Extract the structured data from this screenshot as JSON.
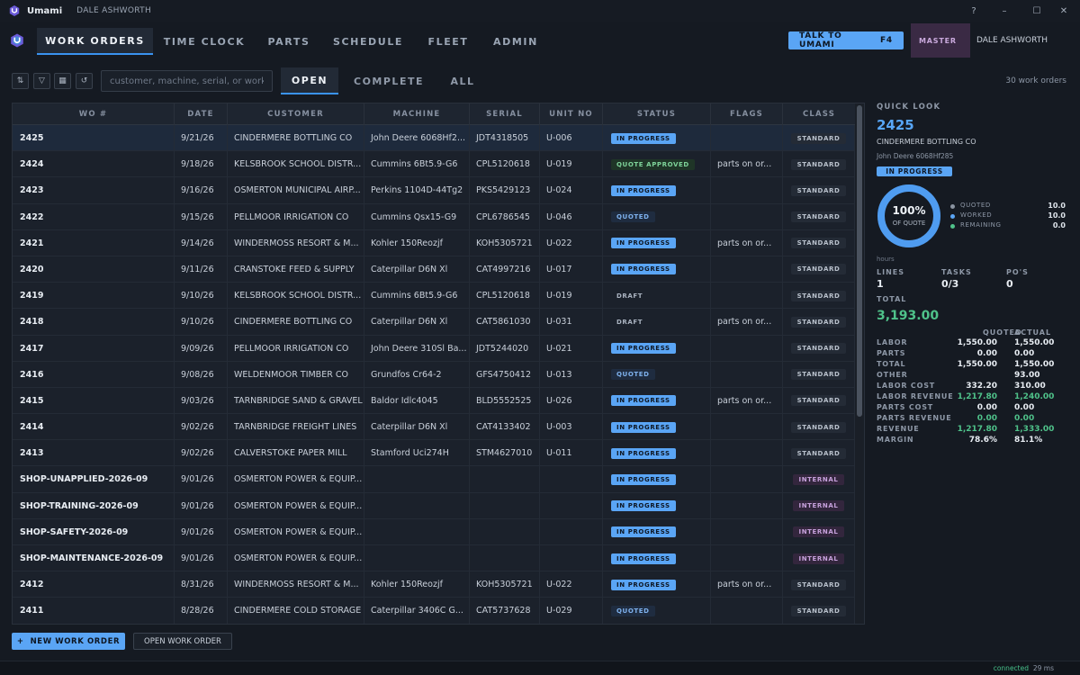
{
  "app": {
    "name": "Umami",
    "user": "DALE ASHWORTH"
  },
  "window_controls": {
    "help": "?",
    "minimize": "–",
    "maximize": "☐",
    "close": "✕"
  },
  "nav": {
    "tabs": [
      {
        "label": "WORK ORDERS",
        "active": true
      },
      {
        "label": "TIME CLOCK"
      },
      {
        "label": "PARTS"
      },
      {
        "label": "SCHEDULE"
      },
      {
        "label": "FLEET"
      },
      {
        "label": "ADMIN"
      }
    ],
    "talk_label": "TALK TO UMAMI",
    "talk_key": "F4",
    "role": "MASTER",
    "user": "DALE ASHWORTH"
  },
  "toolbar": {
    "icons": [
      "sort-icon",
      "filter-icon",
      "columns-icon",
      "refresh-icon"
    ],
    "search_placeholder": "customer, machine, serial, or work ...",
    "filters": [
      {
        "label": "OPEN",
        "active": true
      },
      {
        "label": "COMPLETE"
      },
      {
        "label": "ALL"
      }
    ],
    "count_text": "30 work orders"
  },
  "table": {
    "columns": [
      "WO #",
      "DATE",
      "CUSTOMER",
      "MACHINE",
      "SERIAL",
      "UNIT NO",
      "STATUS",
      "FLAGS",
      "CLASS"
    ],
    "rows": [
      {
        "wo": "2425",
        "date": "9/21/26",
        "customer": "CINDERMERE BOTTLING CO",
        "machine": "John Deere 6068Hf2...",
        "serial": "JDT4318505",
        "unit": "U-006",
        "status": "IN PROGRESS",
        "status_kind": "inprog",
        "flags": "",
        "cls": "STANDARD",
        "cls_kind": "standard",
        "selected": true
      },
      {
        "wo": "2424",
        "date": "9/18/26",
        "customer": "KELSBROOK SCHOOL DISTR...",
        "machine": "Cummins 6Bt5.9-G6",
        "serial": "CPL5120618",
        "unit": "U-019",
        "status": "QUOTE APPROVED",
        "status_kind": "approved",
        "flags": "parts on or...",
        "cls": "STANDARD",
        "cls_kind": "standard"
      },
      {
        "wo": "2423",
        "date": "9/16/26",
        "customer": "OSMERTON MUNICIPAL AIRP...",
        "machine": "Perkins 1104D-44Tg2",
        "serial": "PKS5429123",
        "unit": "U-024",
        "status": "IN PROGRESS",
        "status_kind": "inprog",
        "flags": "",
        "cls": "STANDARD",
        "cls_kind": "standard"
      },
      {
        "wo": "2422",
        "date": "9/15/26",
        "customer": "PELLMOOR IRRIGATION CO",
        "machine": "Cummins Qsx15-G9",
        "serial": "CPL6786545",
        "unit": "U-046",
        "status": "QUOTED",
        "status_kind": "quoted",
        "flags": "",
        "cls": "STANDARD",
        "cls_kind": "standard"
      },
      {
        "wo": "2421",
        "date": "9/14/26",
        "customer": "WINDERMOSS RESORT & M...",
        "machine": "Kohler 150Reozjf",
        "serial": "KOH5305721",
        "unit": "U-022",
        "status": "IN PROGRESS",
        "status_kind": "inprog",
        "flags": "parts on or...",
        "cls": "STANDARD",
        "cls_kind": "standard"
      },
      {
        "wo": "2420",
        "date": "9/11/26",
        "customer": "CRANSTOKE FEED & SUPPLY",
        "machine": "Caterpillar D6N Xl",
        "serial": "CAT4997216",
        "unit": "U-017",
        "status": "IN PROGRESS",
        "status_kind": "inprog",
        "flags": "",
        "cls": "STANDARD",
        "cls_kind": "standard"
      },
      {
        "wo": "2419",
        "date": "9/10/26",
        "customer": "KELSBROOK SCHOOL DISTR...",
        "machine": "Cummins 6Bt5.9-G6",
        "serial": "CPL5120618",
        "unit": "U-019",
        "status": "DRAFT",
        "status_kind": "draft",
        "flags": "",
        "cls": "STANDARD",
        "cls_kind": "standard"
      },
      {
        "wo": "2418",
        "date": "9/10/26",
        "customer": "CINDERMERE BOTTLING CO",
        "machine": "Caterpillar D6N Xl",
        "serial": "CAT5861030",
        "unit": "U-031",
        "status": "DRAFT",
        "status_kind": "draft",
        "flags": "parts on or...",
        "cls": "STANDARD",
        "cls_kind": "standard"
      },
      {
        "wo": "2417",
        "date": "9/09/26",
        "customer": "PELLMOOR IRRIGATION CO",
        "machine": "John Deere 310Sl Ba...",
        "serial": "JDT5244020",
        "unit": "U-021",
        "status": "IN PROGRESS",
        "status_kind": "inprog",
        "flags": "",
        "cls": "STANDARD",
        "cls_kind": "standard"
      },
      {
        "wo": "2416",
        "date": "9/08/26",
        "customer": "WELDENMOOR TIMBER CO",
        "machine": "Grundfos Cr64-2",
        "serial": "GFS4750412",
        "unit": "U-013",
        "status": "QUOTED",
        "status_kind": "quoted",
        "flags": "",
        "cls": "STANDARD",
        "cls_kind": "standard"
      },
      {
        "wo": "2415",
        "date": "9/03/26",
        "customer": "TARNBRIDGE SAND & GRAVEL",
        "machine": "Baldor Idlc4045",
        "serial": "BLD5552525",
        "unit": "U-026",
        "status": "IN PROGRESS",
        "status_kind": "inprog",
        "flags": "parts on or...",
        "cls": "STANDARD",
        "cls_kind": "standard"
      },
      {
        "wo": "2414",
        "date": "9/02/26",
        "customer": "TARNBRIDGE FREIGHT LINES",
        "machine": "Caterpillar D6N Xl",
        "serial": "CAT4133402",
        "unit": "U-003",
        "status": "IN PROGRESS",
        "status_kind": "inprog",
        "flags": "",
        "cls": "STANDARD",
        "cls_kind": "standard"
      },
      {
        "wo": "2413",
        "date": "9/02/26",
        "customer": "CALVERSTOKE PAPER MILL",
        "machine": "Stamford Uci274H",
        "serial": "STM4627010",
        "unit": "U-011",
        "status": "IN PROGRESS",
        "status_kind": "inprog",
        "flags": "",
        "cls": "STANDARD",
        "cls_kind": "standard"
      },
      {
        "wo": "SHOP-UNAPPLIED-2026-09",
        "date": "9/01/26",
        "customer": "OSMERTON POWER & EQUIP...",
        "machine": "",
        "serial": "",
        "unit": "",
        "status": "IN PROGRESS",
        "status_kind": "inprog",
        "flags": "",
        "cls": "INTERNAL",
        "cls_kind": "internal"
      },
      {
        "wo": "SHOP-TRAINING-2026-09",
        "date": "9/01/26",
        "customer": "OSMERTON POWER & EQUIP...",
        "machine": "",
        "serial": "",
        "unit": "",
        "status": "IN PROGRESS",
        "status_kind": "inprog",
        "flags": "",
        "cls": "INTERNAL",
        "cls_kind": "internal"
      },
      {
        "wo": "SHOP-SAFETY-2026-09",
        "date": "9/01/26",
        "customer": "OSMERTON POWER & EQUIP...",
        "machine": "",
        "serial": "",
        "unit": "",
        "status": "IN PROGRESS",
        "status_kind": "inprog",
        "flags": "",
        "cls": "INTERNAL",
        "cls_kind": "internal"
      },
      {
        "wo": "SHOP-MAINTENANCE-2026-09",
        "date": "9/01/26",
        "customer": "OSMERTON POWER & EQUIP...",
        "machine": "",
        "serial": "",
        "unit": "",
        "status": "IN PROGRESS",
        "status_kind": "inprog",
        "flags": "",
        "cls": "INTERNAL",
        "cls_kind": "internal"
      },
      {
        "wo": "2412",
        "date": "8/31/26",
        "customer": "WINDERMOSS RESORT & M...",
        "machine": "Kohler 150Reozjf",
        "serial": "KOH5305721",
        "unit": "U-022",
        "status": "IN PROGRESS",
        "status_kind": "inprog",
        "flags": "parts on or...",
        "cls": "STANDARD",
        "cls_kind": "standard"
      },
      {
        "wo": "2411",
        "date": "8/28/26",
        "customer": "CINDERMERE COLD STORAGE",
        "machine": "Caterpillar 3406C G...",
        "serial": "CAT5737628",
        "unit": "U-029",
        "status": "QUOTED",
        "status_kind": "quoted",
        "flags": "",
        "cls": "STANDARD",
        "cls_kind": "standard"
      }
    ]
  },
  "actions": {
    "new_wo": "NEW WORK ORDER",
    "new_wo_icon": "+",
    "open_wo": "OPEN WORK ORDER"
  },
  "status_bar": {
    "connection": "connected",
    "separator": "·",
    "latency": "29 ms"
  },
  "quick_look": {
    "title": "QUICK LOOK",
    "wo": "2425",
    "customer": "CINDERMERE BOTTLING CO",
    "machine": "John Deere 6068Hf285",
    "status": "IN PROGRESS",
    "pct": "100%",
    "pct_label": "OF QUOTE",
    "pct_value": 1.0,
    "legend": [
      {
        "name": "QUOTED",
        "value": "10.0",
        "color": "#8a93a0"
      },
      {
        "name": "WORKED",
        "value": "10.0",
        "color": "#5aa5f5"
      },
      {
        "name": "REMAINING",
        "value": "0.0",
        "color": "#4fc28a"
      }
    ],
    "hours_label": "hours",
    "kpis": [
      {
        "label": "LINES",
        "value": "1"
      },
      {
        "label": "TASKS",
        "value": "0/3"
      },
      {
        "label": "PO'S",
        "value": "0"
      }
    ],
    "total_label": "TOTAL",
    "total_value": "3,193.00",
    "fin_headers": {
      "quoted": "QUOTED",
      "actual": "ACTUAL"
    },
    "financials": [
      {
        "label": "LABOR",
        "quoted": "1,550.00",
        "actual": "1,550.00"
      },
      {
        "label": "PARTS",
        "quoted": "0.00",
        "actual": "0.00"
      },
      {
        "label": "TOTAL",
        "quoted": "1,550.00",
        "actual": "1,550.00"
      },
      {
        "label": "OTHER",
        "quoted": "",
        "actual": "93.00"
      },
      {
        "label": "LABOR COST",
        "quoted": "332.20",
        "actual": "310.00"
      },
      {
        "label": "LABOR REVENUE",
        "quoted": "1,217.80",
        "actual": "1,240.00",
        "green": true
      },
      {
        "label": "PARTS COST",
        "quoted": "0.00",
        "actual": "0.00"
      },
      {
        "label": "PARTS REVENUE",
        "quoted": "0.00",
        "actual": "0.00",
        "green": true
      },
      {
        "label": "REVENUE",
        "quoted": "1,217.80",
        "actual": "1,333.00",
        "green": true
      },
      {
        "label": "MARGIN",
        "quoted": "78.6%",
        "actual": "81.1%"
      }
    ]
  },
  "colors": {
    "accent": "#5aa5f5",
    "positive": "#4fc28a",
    "internal": "#c7a1dc"
  }
}
